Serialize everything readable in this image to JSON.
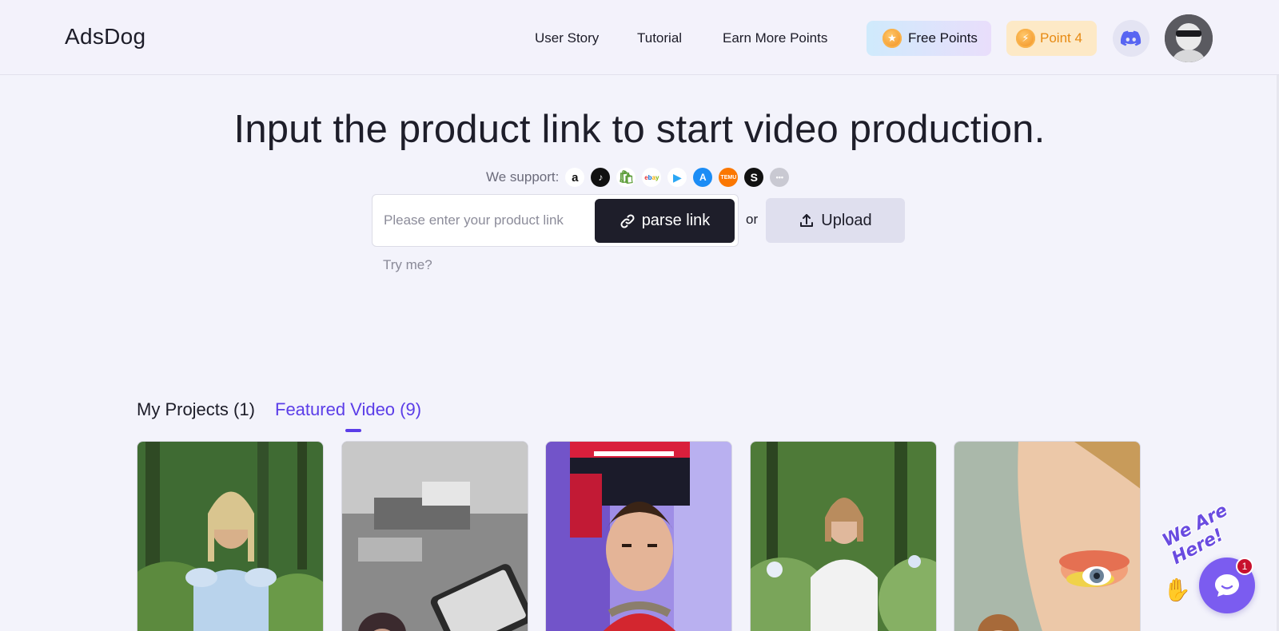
{
  "header": {
    "brand": "AdsDog",
    "nav": [
      "User Story",
      "Tutorial",
      "Earn More Points"
    ],
    "free_points_label": "Free Points",
    "points_label": "Point 4",
    "discord_icon": "discord-icon",
    "avatar_icon": "user-avatar"
  },
  "hero": {
    "title": "Input the product link to start video production.",
    "support_label": "We support:",
    "platforms": [
      {
        "name": "amazon",
        "glyph": "a",
        "color": "#ffffff",
        "fg": "#111111"
      },
      {
        "name": "tiktok",
        "glyph": "♪",
        "color": "#111111",
        "fg": "#ffffff"
      },
      {
        "name": "shopify",
        "glyph": "S",
        "color": "#ffffff",
        "fg": "#5e9e3a"
      },
      {
        "name": "ebay",
        "glyph": "ebay",
        "color": "#ffffff",
        "fg": "#e53238"
      },
      {
        "name": "google-play",
        "glyph": "▶",
        "color": "#ffffff",
        "fg": "#2aa6f4"
      },
      {
        "name": "app-store",
        "glyph": "A",
        "color": "#1b8cf5",
        "fg": "#ffffff"
      },
      {
        "name": "temu",
        "glyph": "T",
        "color": "#fb7701",
        "fg": "#ffffff"
      },
      {
        "name": "shein",
        "glyph": "S",
        "color": "#111111",
        "fg": "#ffffff"
      },
      {
        "name": "more",
        "glyph": "•••",
        "color": "#c9c9d2",
        "fg": "#ffffff"
      }
    ],
    "input_placeholder": "Please enter your product link",
    "parse_button": "parse link",
    "or_text": "or",
    "upload_button": "Upload",
    "try_me": "Try me?"
  },
  "tabs": {
    "my_projects": "My Projects (1)",
    "featured": "Featured Video (9)"
  },
  "chat": {
    "badge_count": "1",
    "wave_text": "We Are Here!"
  },
  "colors": {
    "accent": "#5b3de8",
    "dark_button": "#1e1e2a",
    "points_orange": "#e78a12"
  }
}
